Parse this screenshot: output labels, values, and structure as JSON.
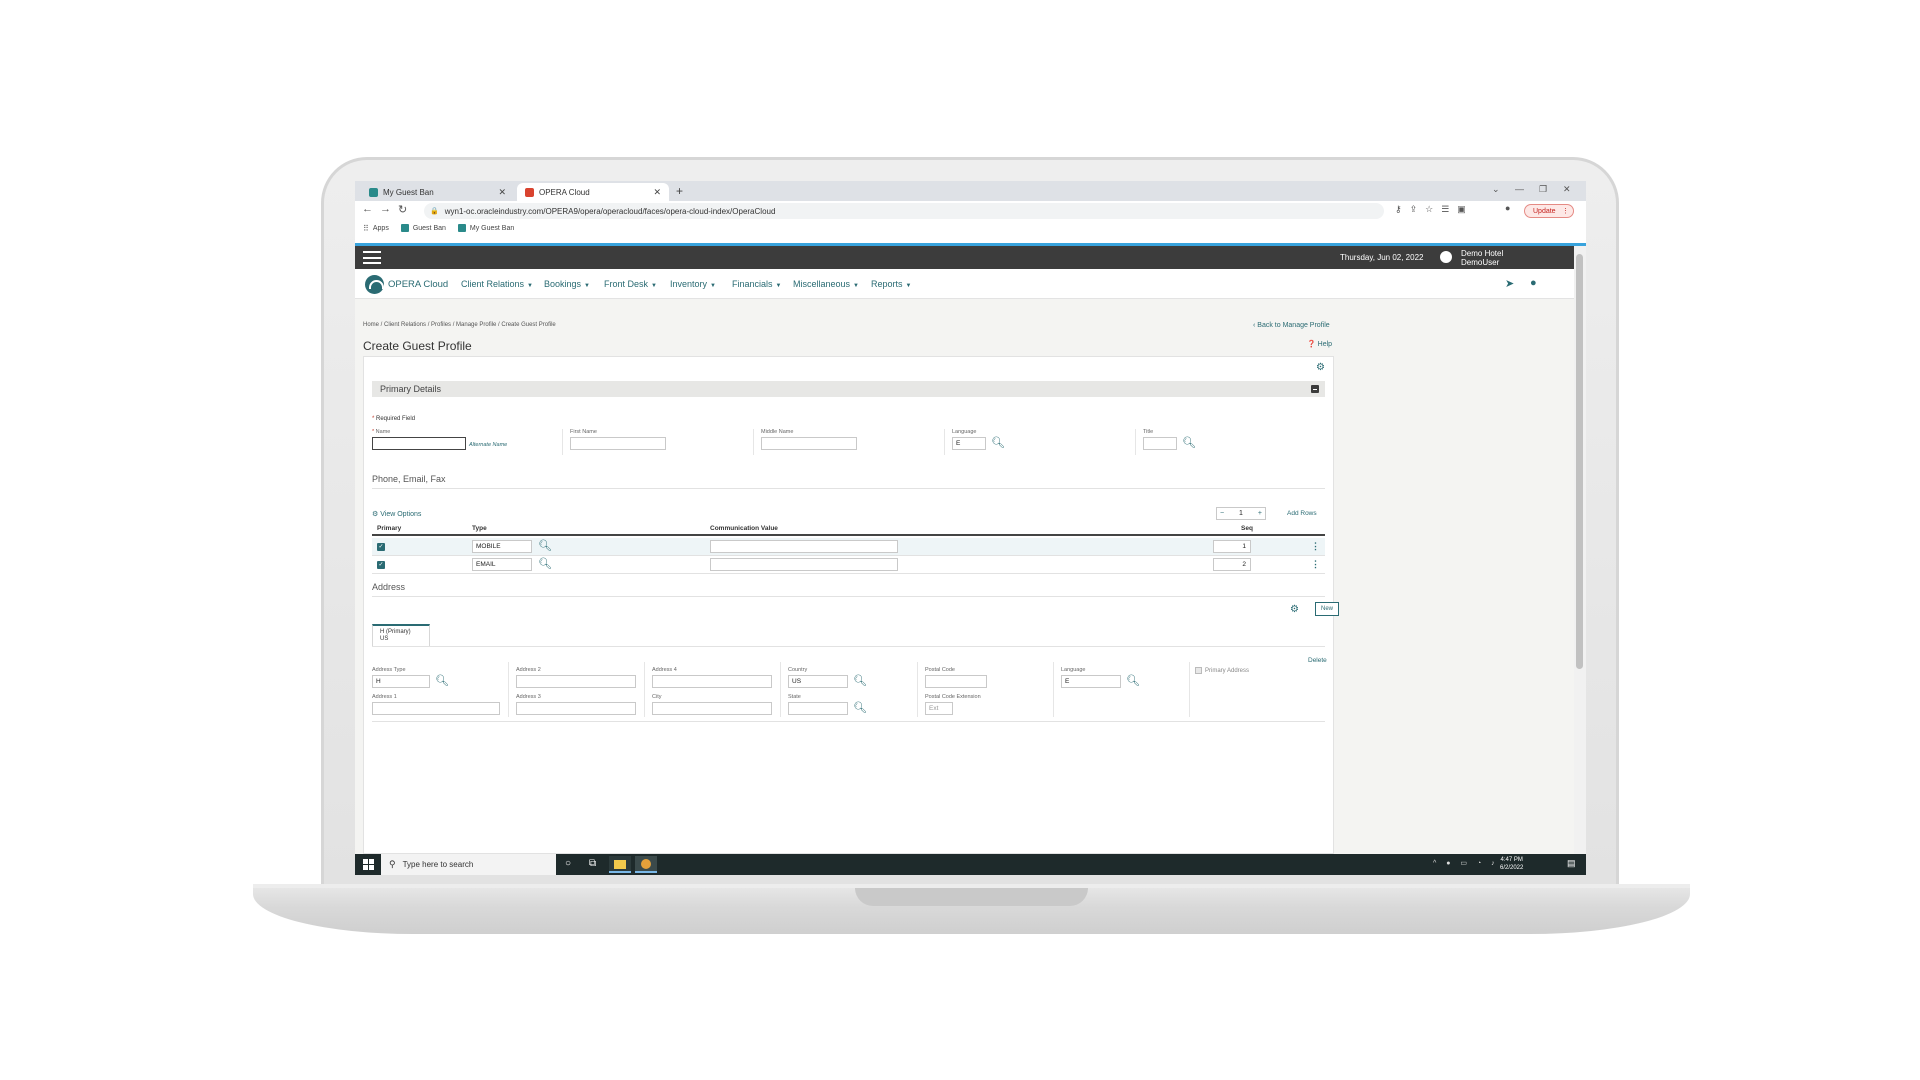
{
  "browser": {
    "tabs": [
      {
        "label": "My Guest Ban",
        "active": false
      },
      {
        "label": "OPERA Cloud",
        "active": true
      }
    ],
    "new_tab": "+",
    "url": "wyn1-oc.oracleindustry.com/OPERA9/opera/operacloud/faces/opera-cloud-index/OperaCloud",
    "update_label": "Update",
    "bookmarks": [
      "Apps",
      "Guest Ban",
      "My Guest Ban"
    ]
  },
  "app": {
    "top_date": "Thursday, Jun 02, 2022",
    "hotel_name": "Demo Hotel",
    "user_name": "DemoUser",
    "brand": "OPERA Cloud",
    "menu": [
      "Client Relations",
      "Bookings",
      "Front Desk",
      "Inventory",
      "Financials",
      "Miscellaneous",
      "Reports"
    ],
    "breadcrumb": "Home / Client Relations / Profiles / Manage Profile / Create Guest Profile",
    "back_link": "Back to Manage Profile",
    "page_title": "Create Guest Profile",
    "help": "Help"
  },
  "primary_details": {
    "section_title": "Primary Details",
    "required_note": "Required Field",
    "name_label": "Name",
    "alternate_name": "Alternate Name",
    "first_name_label": "First Name",
    "middle_name_label": "Middle Name",
    "language_label": "Language",
    "language_value": "E",
    "title_label": "Title"
  },
  "communications": {
    "section_title": "Phone, Email, Fax",
    "view_options": "View Options",
    "stepper_value": "1",
    "add_rows": "Add Rows",
    "columns": [
      "Primary",
      "Type",
      "Communication Value",
      "Seq"
    ],
    "rows": [
      {
        "type": "MOBILE",
        "value": "",
        "seq": "1",
        "primary": true
      },
      {
        "type": "EMAIL",
        "value": "",
        "seq": "2",
        "primary": true
      }
    ]
  },
  "address": {
    "section_title": "Address",
    "new_button": "New",
    "tab_line1": "H (Primary)",
    "tab_line2": "US",
    "delete": "Delete",
    "fields": {
      "address_type_label": "Address Type",
      "address_type_value": "H",
      "address1_label": "Address 1",
      "address2_label": "Address 2",
      "address3_label": "Address 3",
      "address4_label": "Address 4",
      "city_label": "City",
      "country_label": "Country",
      "country_value": "US",
      "state_label": "State",
      "postal_code_label": "Postal Code",
      "postal_ext_label": "Postal Code Extension",
      "postal_ext_placeholder": "Ext",
      "language_label": "Language",
      "language_value": "E",
      "primary_address_label": "Primary Address"
    }
  },
  "taskbar": {
    "search_placeholder": "Type here to search",
    "time": "4:47 PM",
    "date": "6/2/2022"
  }
}
